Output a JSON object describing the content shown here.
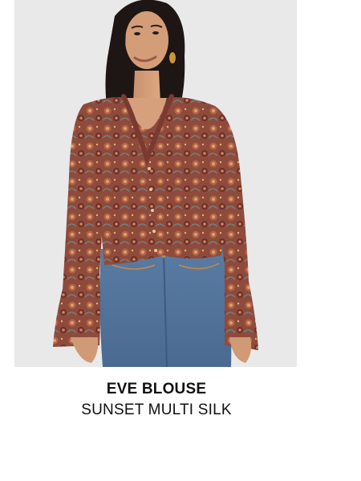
{
  "product": {
    "name": "EVE BLOUSE",
    "color": "SUNSET MULTI SILK"
  },
  "colors": {
    "background": "#ffffff",
    "image_background": "#e9e9ea",
    "text": "#111111",
    "blouse": "#8a4a3a",
    "denim": "#4f7196"
  }
}
